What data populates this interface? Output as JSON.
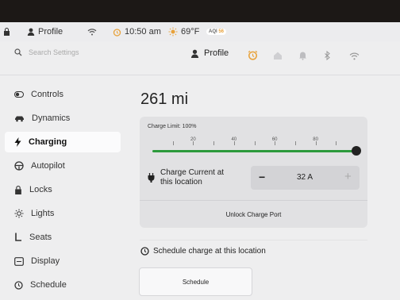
{
  "status_bar": {
    "profile_label": "Profile",
    "time": "10:50 am",
    "temperature": "69°F",
    "aqi_label": "AQI",
    "aqi_value": "56"
  },
  "header": {
    "search_placeholder": "Search Settings",
    "profile_label": "Profile",
    "icons": [
      "alarm-icon",
      "home-icon",
      "bell-icon",
      "bluetooth-icon",
      "wifi-icon"
    ]
  },
  "sidebar": {
    "items": [
      {
        "label": "Controls",
        "icon": "toggle-icon",
        "active": false
      },
      {
        "label": "Dynamics",
        "icon": "car-icon",
        "active": false
      },
      {
        "label": "Charging",
        "icon": "bolt-icon",
        "active": true
      },
      {
        "label": "Autopilot",
        "icon": "steering-wheel-icon",
        "active": false
      },
      {
        "label": "Locks",
        "icon": "lock-icon",
        "active": false
      },
      {
        "label": "Lights",
        "icon": "sun-icon",
        "active": false
      },
      {
        "label": "Seats",
        "icon": "seat-icon",
        "active": false
      },
      {
        "label": "Display",
        "icon": "display-icon",
        "active": false
      },
      {
        "label": "Schedule",
        "icon": "clock-icon",
        "active": false
      }
    ]
  },
  "charging": {
    "range": "261 mi",
    "charge_limit_label": "Charge Limit: 100%",
    "charge_limit_fraction": 1.0,
    "slider_ticks": [
      "20",
      "40",
      "60",
      "80"
    ],
    "charge_current_label_line1": "Charge Current at",
    "charge_current_label_line2": "this location",
    "current_minus": "−",
    "current_value": "32 A",
    "current_plus": "+",
    "unlock_label": "Unlock Charge Port",
    "schedule_title": "Schedule charge at this location",
    "schedule_button": "Schedule"
  },
  "colors": {
    "accent_green": "#2c9a3c",
    "alarm_orange": "#e8a23b"
  }
}
